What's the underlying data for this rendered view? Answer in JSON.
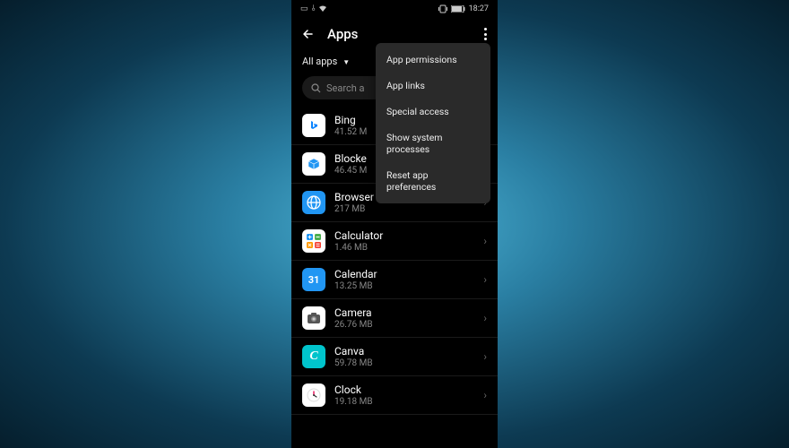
{
  "status_bar": {
    "time": "18:27",
    "battery_icon": "battery-icon",
    "vibrate_icon": "vibrate-icon"
  },
  "header": {
    "title": "Apps"
  },
  "filter": {
    "label": "All apps"
  },
  "search": {
    "placeholder": "Search a"
  },
  "apps": [
    {
      "name": "Bing",
      "size": "41.52 M"
    },
    {
      "name": "Blocke",
      "size": "46.45 M"
    },
    {
      "name": "Browser",
      "size": "217 MB"
    },
    {
      "name": "Calculator",
      "size": "1.46 MB"
    },
    {
      "name": "Calendar",
      "size": "13.25 MB"
    },
    {
      "name": "Camera",
      "size": "26.76 MB"
    },
    {
      "name": "Canva",
      "size": "59.78 MB"
    },
    {
      "name": "Clock",
      "size": "19.18 MB"
    }
  ],
  "popup": {
    "items": [
      "App permissions",
      "App links",
      "Special access",
      "Show system processes",
      "Reset app preferences"
    ]
  },
  "icons": {
    "calendar_day": "31",
    "canva_letter": "C"
  }
}
